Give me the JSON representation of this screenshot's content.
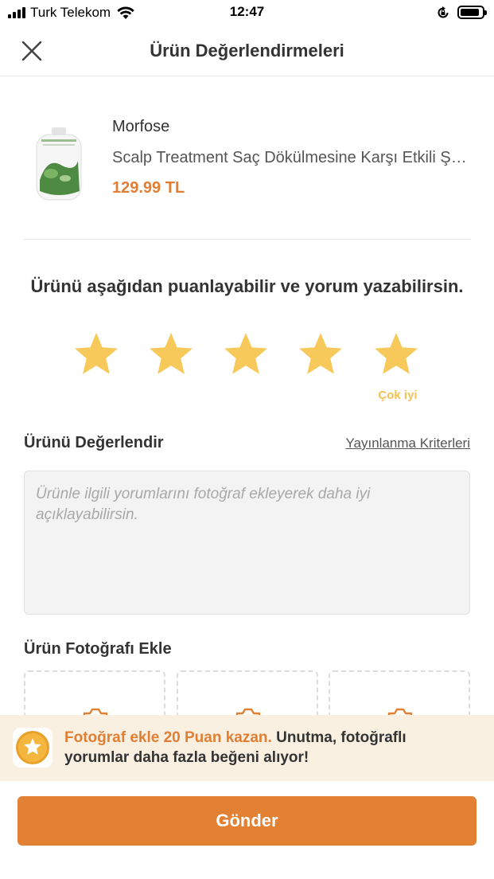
{
  "status_bar": {
    "carrier": "Turk Telekom",
    "time": "12:47",
    "icons": [
      "signal-bars-icon",
      "wifi-icon",
      "orientation-lock-icon",
      "battery-icon"
    ]
  },
  "nav": {
    "title": "Ürün Değerlendirmeleri",
    "close_icon": "close-icon"
  },
  "product": {
    "brand": "Morfose",
    "name": "Scalp Treatment Saç Dökülmesine Karşı Etkili Şampuan",
    "price": "129.99 TL",
    "price_color": "#e07f33"
  },
  "rating": {
    "prompt": "Ürünü aşağıdan puanlayabilir ve yorum yazabilirsin.",
    "selected": 5,
    "max": 5,
    "selected_label": "Çok iyi",
    "star_color": "#f7c95a"
  },
  "review": {
    "title": "Ürünü Değerlendir",
    "criteria_link": "Yayınlanma Kriterleri",
    "placeholder": "Ürünle ilgili yorumlarını fotoğraf ekleyerek daha iyi açıklayabilirsin.",
    "value": ""
  },
  "photos": {
    "title": "Ürün Fotoğrafı Ekle",
    "slot_icon": "camera-icon"
  },
  "banner": {
    "highlight": "Fotoğraf ekle 20 Puan kazan.",
    "text": " Unutma, fotoğraflı yorumlar daha fazla beğeni alıyor!",
    "icon": "star-coin-icon",
    "background": "#faf0e2"
  },
  "submit": {
    "label": "Gönder",
    "color": "#e28034"
  }
}
